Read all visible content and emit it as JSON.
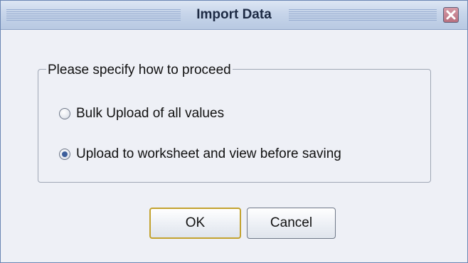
{
  "dialog": {
    "title": "Import Data",
    "close_icon": "close-icon"
  },
  "group": {
    "legend": "Please specify how to proceed",
    "options": [
      {
        "label": "Bulk Upload of all values",
        "selected": false
      },
      {
        "label": "Upload to worksheet and view before saving",
        "selected": true
      }
    ]
  },
  "buttons": {
    "ok_label": "OK",
    "cancel_label": "Cancel"
  },
  "colors": {
    "accent": "#3d5f9b",
    "default_button_border": "#c3a22e",
    "close_button": "#b9707f"
  }
}
